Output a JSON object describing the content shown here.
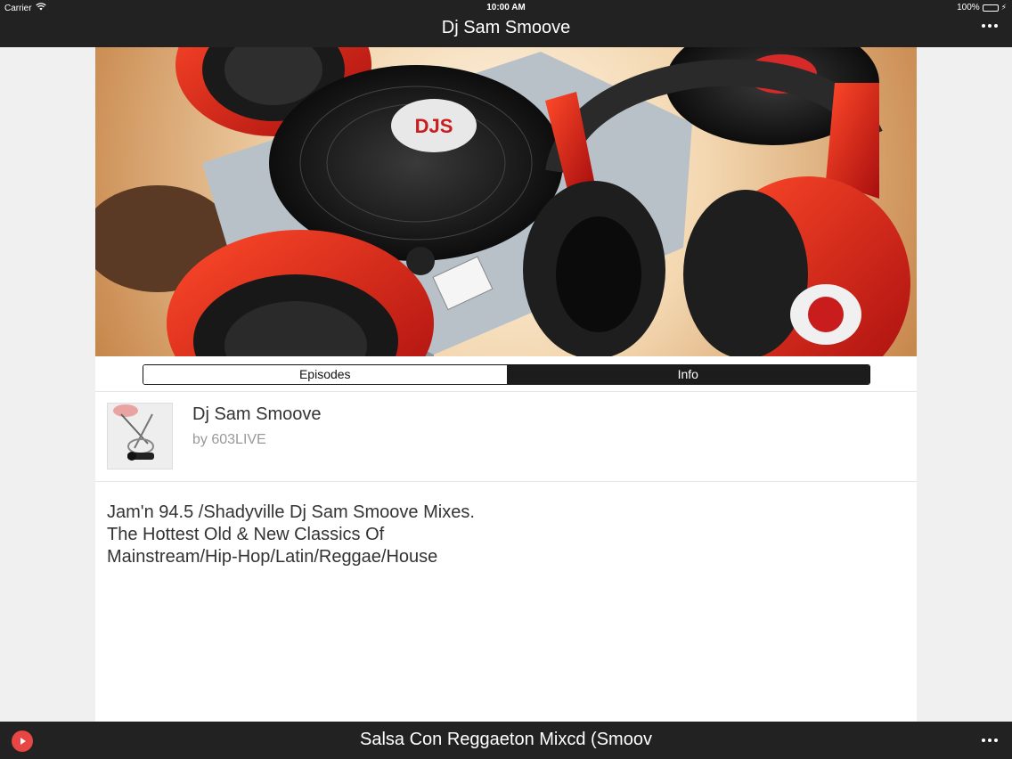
{
  "status": {
    "carrier": "Carrier",
    "time": "10:00 AM",
    "battery": "100%"
  },
  "nav": {
    "title": "Dj Sam Smoove"
  },
  "tabs": {
    "episodes": "Episodes",
    "info": "Info",
    "active": "info"
  },
  "show": {
    "title": "Dj Sam Smoove",
    "author": "by 603LIVE"
  },
  "description": {
    "line1": "Jam'n 94.5 /Shadyville Dj Sam Smoove Mixes.",
    "line2": "The Hottest Old & New Classics Of",
    "line3": "Mainstream/Hip-Hop/Latin/Reggae/House"
  },
  "player": {
    "track": "Salsa Con Reggaeton Mixcd (Smoov"
  },
  "colors": {
    "bar": "#222222",
    "accent": "#e84545",
    "battery": "#4cd964"
  },
  "icons": [
    "wifi-icon",
    "battery-icon",
    "more-icon",
    "play-icon"
  ]
}
